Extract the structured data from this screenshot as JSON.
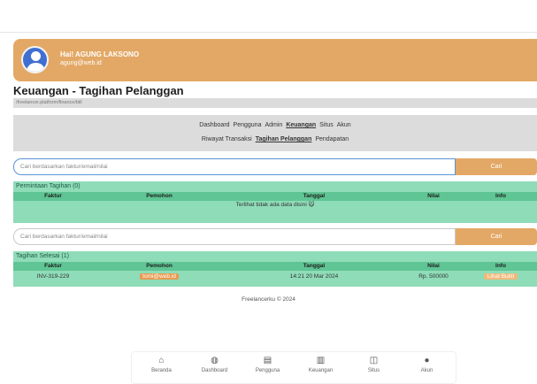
{
  "header": {
    "greeting": "Hai! AGUNG LAKSONO",
    "email": "agung@web.id"
  },
  "page": {
    "title": "Keuangan - Tagihan Pelanggan",
    "breadcrumb": "/freelancer.platform/finance/bill"
  },
  "nav": {
    "primary": [
      "Dashboard",
      "Pengguna",
      "Admin",
      "Keuangan",
      "Situs",
      "Akun"
    ],
    "primary_active": "Keuangan",
    "secondary": [
      "Riwayat Transaksi",
      "Tagihan Pelanggan",
      "Pendapatan"
    ],
    "secondary_active": "Tagihan Pelanggan"
  },
  "search1": {
    "placeholder": "Cari berdasarkan faktur/email/nilai",
    "button": "Cari"
  },
  "search2": {
    "placeholder": "Cari berdasarkan faktur/email/nilai",
    "button": "Cari"
  },
  "requests": {
    "title": "Permintaan Tagihan (0)",
    "columns": [
      "Faktur",
      "Pemohon",
      "Tanggal",
      "Nilai",
      "Info"
    ],
    "empty_text": "Terlihat tidak ada data disini 🙀"
  },
  "completed": {
    "title": "Tagihan Selesai (1)",
    "columns": [
      "Faktur",
      "Pemohon",
      "Tanggal",
      "Nilai",
      "Info"
    ],
    "rows": [
      {
        "faktur": "INV-319-229",
        "pemohon": "tomi@web.id",
        "tanggal": "14:21 20 Mar 2024",
        "nilai": "Rp. 500000",
        "info": "Lihat Bukti"
      }
    ]
  },
  "footer": "Freelancerku © 2024",
  "bottom_nav": [
    {
      "label": "Beranda",
      "icon": "home-icon",
      "glyph": "⌂"
    },
    {
      "label": "Dashboard",
      "icon": "dashboard-icon",
      "glyph": "◍"
    },
    {
      "label": "Pengguna",
      "icon": "users-icon",
      "glyph": "▤"
    },
    {
      "label": "Keuangan",
      "icon": "finance-icon",
      "glyph": "▥"
    },
    {
      "label": "Situs",
      "icon": "site-icon",
      "glyph": "◫"
    },
    {
      "label": "Akun",
      "icon": "account-icon",
      "glyph": "●"
    }
  ],
  "colors": {
    "accent": "#e3a865",
    "table_bg": "#8fdcb8",
    "table_head": "#5fc594",
    "link_blue": "#5b93d6"
  }
}
